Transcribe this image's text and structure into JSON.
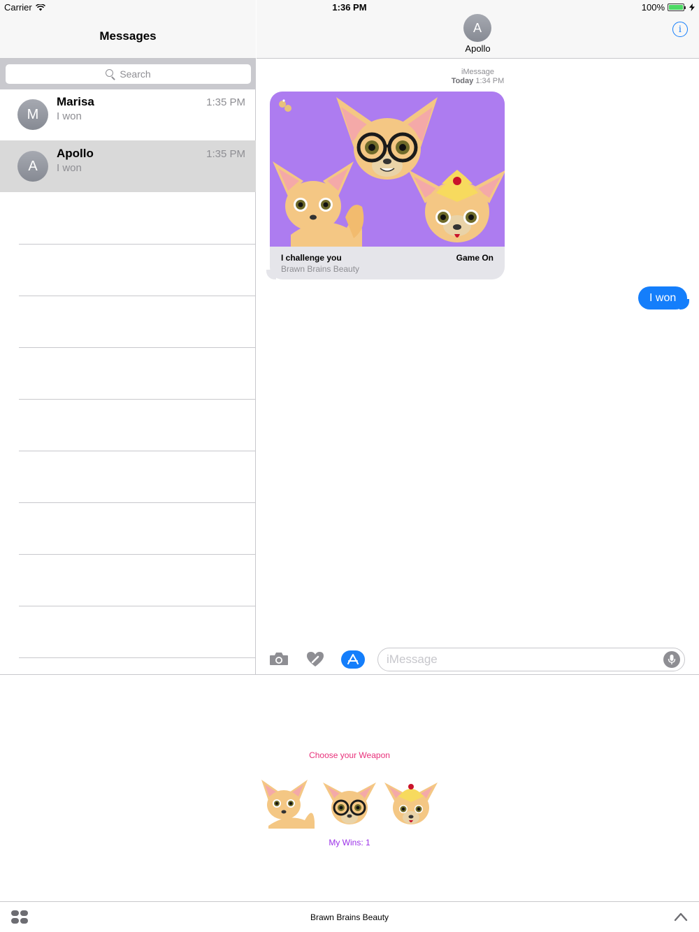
{
  "status": {
    "carrier": "Carrier",
    "time": "1:36 PM",
    "battery": "100%"
  },
  "sidebar": {
    "title": "Messages",
    "search_placeholder": "Search",
    "conversations": [
      {
        "initial": "M",
        "name": "Marisa",
        "preview": "I won",
        "time": "1:35 PM",
        "selected": false
      },
      {
        "initial": "A",
        "name": "Apollo",
        "preview": "I won",
        "time": "1:35 PM",
        "selected": true
      }
    ]
  },
  "chat": {
    "contact_initial": "A",
    "contact_name": "Apollo",
    "service": "iMessage",
    "date_prefix": "Today",
    "date_time": "1:34 PM",
    "card": {
      "title": "I challenge you",
      "subtitle": "Brawn Brains Beauty",
      "action": "Game On"
    },
    "outgoing": "I won",
    "input_placeholder": "iMessage"
  },
  "extension": {
    "heading": "Choose your Weapon",
    "weapons": [
      "brawn-chihuahua",
      "brains-chihuahua",
      "beauty-chihuahua"
    ],
    "wins": "My Wins: 1",
    "app_name": "Brawn Brains Beauty"
  },
  "colors": {
    "accent": "#147efb",
    "card_bg": "#ad7cf0",
    "heading": "#e8307a",
    "wins": "#9b30e8"
  }
}
